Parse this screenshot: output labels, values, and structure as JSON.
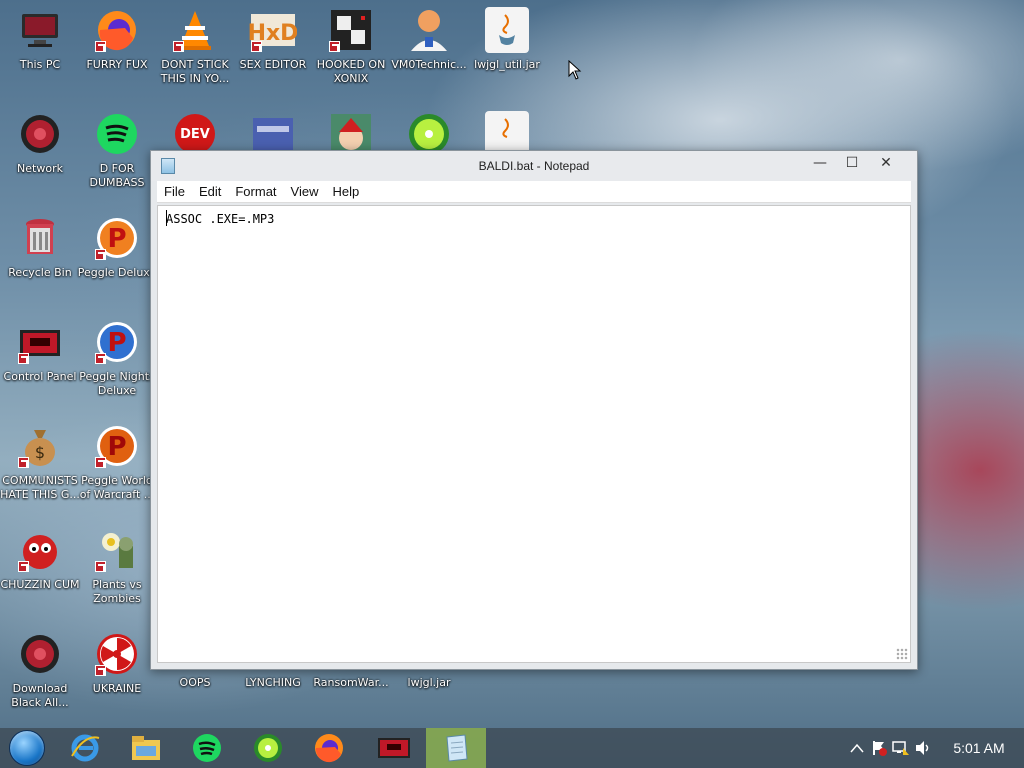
{
  "desktop": {
    "icons": [
      {
        "label": "This PC",
        "icon": "computer-icon"
      },
      {
        "label": "FURRY FUX",
        "icon": "firefox-icon"
      },
      {
        "label": "DONT STICK THIS IN YO...",
        "icon": "vlc-icon"
      },
      {
        "label": "SEX EDITOR",
        "icon": "hxd-icon"
      },
      {
        "label": "HOOKED ON XONIX",
        "icon": "xonix-icon"
      },
      {
        "label": "VM0Technic...",
        "icon": "doctor-icon"
      },
      {
        "label": "lwjgl_util.jar",
        "icon": "java-icon"
      },
      {
        "label": "Network",
        "icon": "network-icon"
      },
      {
        "label": "D FOR DUMBASS",
        "icon": "spotify-icon"
      },
      {
        "label": "Recycle Bin",
        "icon": "recycle-bin-icon"
      },
      {
        "label": "Peggle Deluxe",
        "icon": "peggle-icon"
      },
      {
        "label": "Control Panel",
        "icon": "control-panel-icon"
      },
      {
        "label": "Peggle Nights Deluxe",
        "icon": "peggle-nights-icon"
      },
      {
        "label": "COMMUNISTS HATE THIS G...",
        "icon": "money-bag-icon"
      },
      {
        "label": "Peggle World of Warcraft ...",
        "icon": "peggle-wow-icon"
      },
      {
        "label": "CHUZZIN CUM",
        "icon": "chuzzle-icon"
      },
      {
        "label": "Plants vs Zombies",
        "icon": "pvz-icon"
      },
      {
        "label": "Download Black All...",
        "icon": "download-icon"
      },
      {
        "label": "UKRAINE",
        "icon": "radiation-icon"
      },
      {
        "label": "OOPS",
        "icon": "oops-icon"
      },
      {
        "label": "LYNCHING",
        "icon": "lynching-icon"
      },
      {
        "label": "RansomWar...",
        "icon": "ransomware-icon"
      },
      {
        "label": "lwjgl.jar",
        "icon": "jar-icon"
      }
    ]
  },
  "notepad": {
    "title": "BALDI.bat - Notepad",
    "menu": [
      "File",
      "Edit",
      "Format",
      "View",
      "Help"
    ],
    "content": "ASSOC .EXE=.MP3",
    "buttons": {
      "minimize": "—",
      "maximize": "☐",
      "close": "✕"
    }
  },
  "taskbar": {
    "items": [
      "start-orb",
      "internet-explorer-icon",
      "file-explorer-icon",
      "spotify-icon",
      "limewire-icon",
      "firefox-icon",
      "control-panel-icon",
      "notepad-icon"
    ],
    "active_index": 7,
    "clock": "5:01 AM"
  },
  "colors": {
    "taskbar_active": "#8fbf4a",
    "shortcut_badge": "#c0202a"
  }
}
